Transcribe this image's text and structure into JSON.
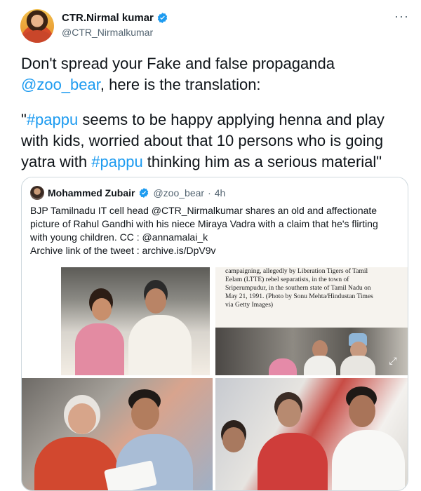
{
  "author": {
    "display_name": "CTR.Nirmal kumar",
    "handle": "@CTR_Nirmalkumar",
    "more_label": "···"
  },
  "body": {
    "line1_text": "Don't spread your Fake and false propaganda ",
    "line2_mention": "@zoo_bear",
    "line2_text": ", here is the translation:",
    "quote_open": "\"",
    "hashtag1": "#pappu",
    "quote_part1": " seems to be happy applying henna and play with kids, worried about that 10 persons who is going yatra with ",
    "hashtag2": "#pappu",
    "quote_part2": " thinking him as a serious material\""
  },
  "quoted": {
    "name": "Mohammed Zubair",
    "handle": "@zoo_bear",
    "dot": "·",
    "time": "4h",
    "text_lines": [
      "BJP Tamilnadu IT cell head @CTR_Nirmalkumar shares an old and affectionate",
      "picture of Rahul Gandhi with his niece Miraya Vadra with a claim that he's flirting",
      "with young children. CC : @annamalai_k",
      "Archive link of the tweet : archive.is/DpV9v"
    ],
    "caption_lines": [
      "campaigning, allegedly by Liberation Tigers of Tamil",
      "Eelam (LTTE) rebel separatists, in the town of",
      "Sriperumpudur, in the southern state of Tamil Nadu on",
      "May 21, 1991. (Photo by Sonu Mehta/Hindustan Times",
      "via Getty Images)"
    ]
  },
  "colors": {
    "link": "#1d9bf0",
    "verified": "#1d9bf0",
    "text": "#0f1419",
    "secondary": "#536471",
    "border": "#cfd9de"
  },
  "icons": [
    "verified-badge-icon",
    "more-icon",
    "expand-icon"
  ]
}
